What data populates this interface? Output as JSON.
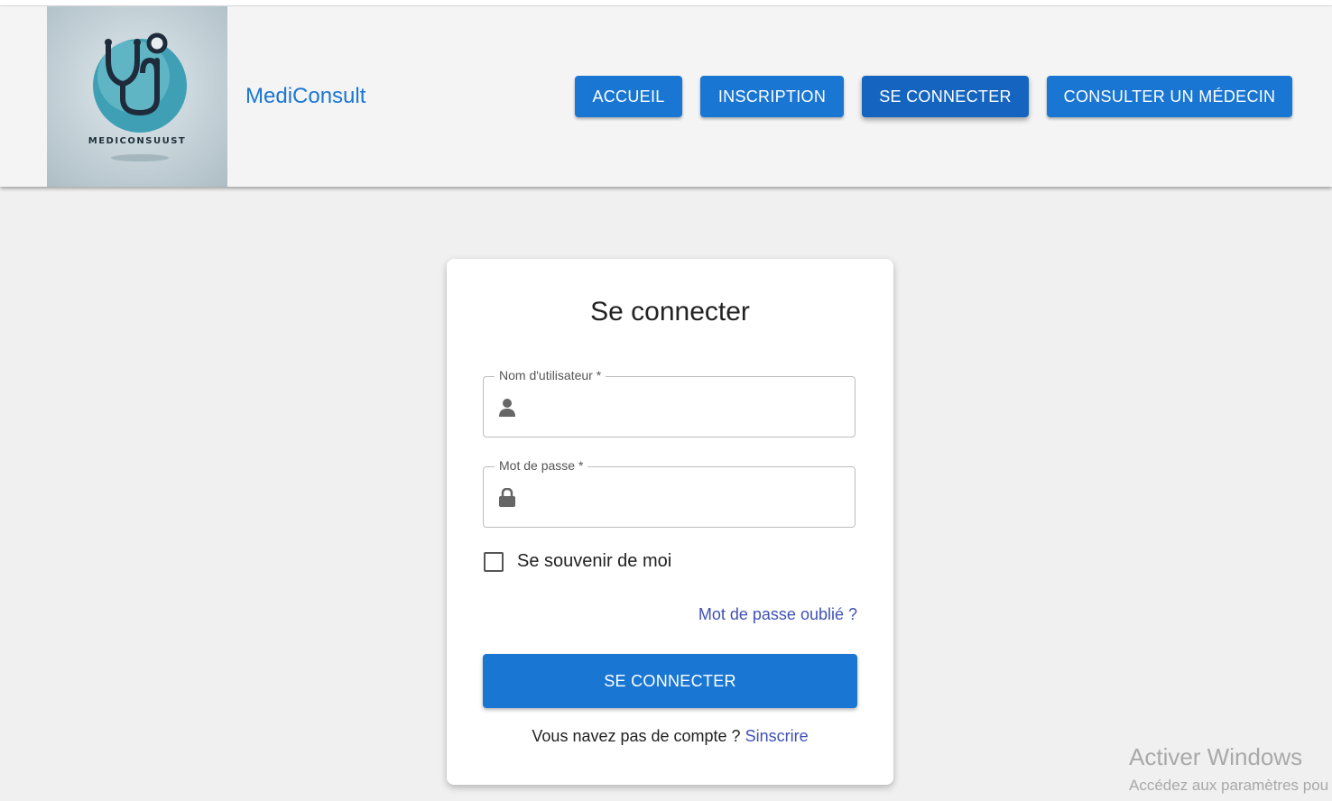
{
  "header": {
    "logo_text": "MEDICONSUUST",
    "brand": "MediConsult",
    "nav": [
      {
        "label": "ACCUEIL"
      },
      {
        "label": "INSCRIPTION"
      },
      {
        "label": "SE CONNECTER",
        "active": true
      },
      {
        "label": "CONSULTER UN MÉDECIN"
      }
    ]
  },
  "login": {
    "title": "Se connecter",
    "username": {
      "label": "Nom d'utilisateur *",
      "value": "",
      "icon": "user-icon"
    },
    "password": {
      "label": "Mot de passe *",
      "value": "",
      "icon": "lock-icon"
    },
    "remember_label": "Se souvenir de moi",
    "remember_checked": false,
    "forgot_label": "Mot de passe oublié ?",
    "submit_label": "SE CONNECTER",
    "no_account_text": "Vous navez pas de compte ?",
    "signup_link": "Sinscrire"
  },
  "watermark": {
    "line1": "Activer Windows",
    "line2": "Accédez aux paramètres pou"
  },
  "colors": {
    "primary": "#1976d2",
    "primary_active": "#1565c0",
    "link": "#3f51b5",
    "page_bg": "#f0f0f0",
    "header_bg": "#f4f4f4"
  }
}
